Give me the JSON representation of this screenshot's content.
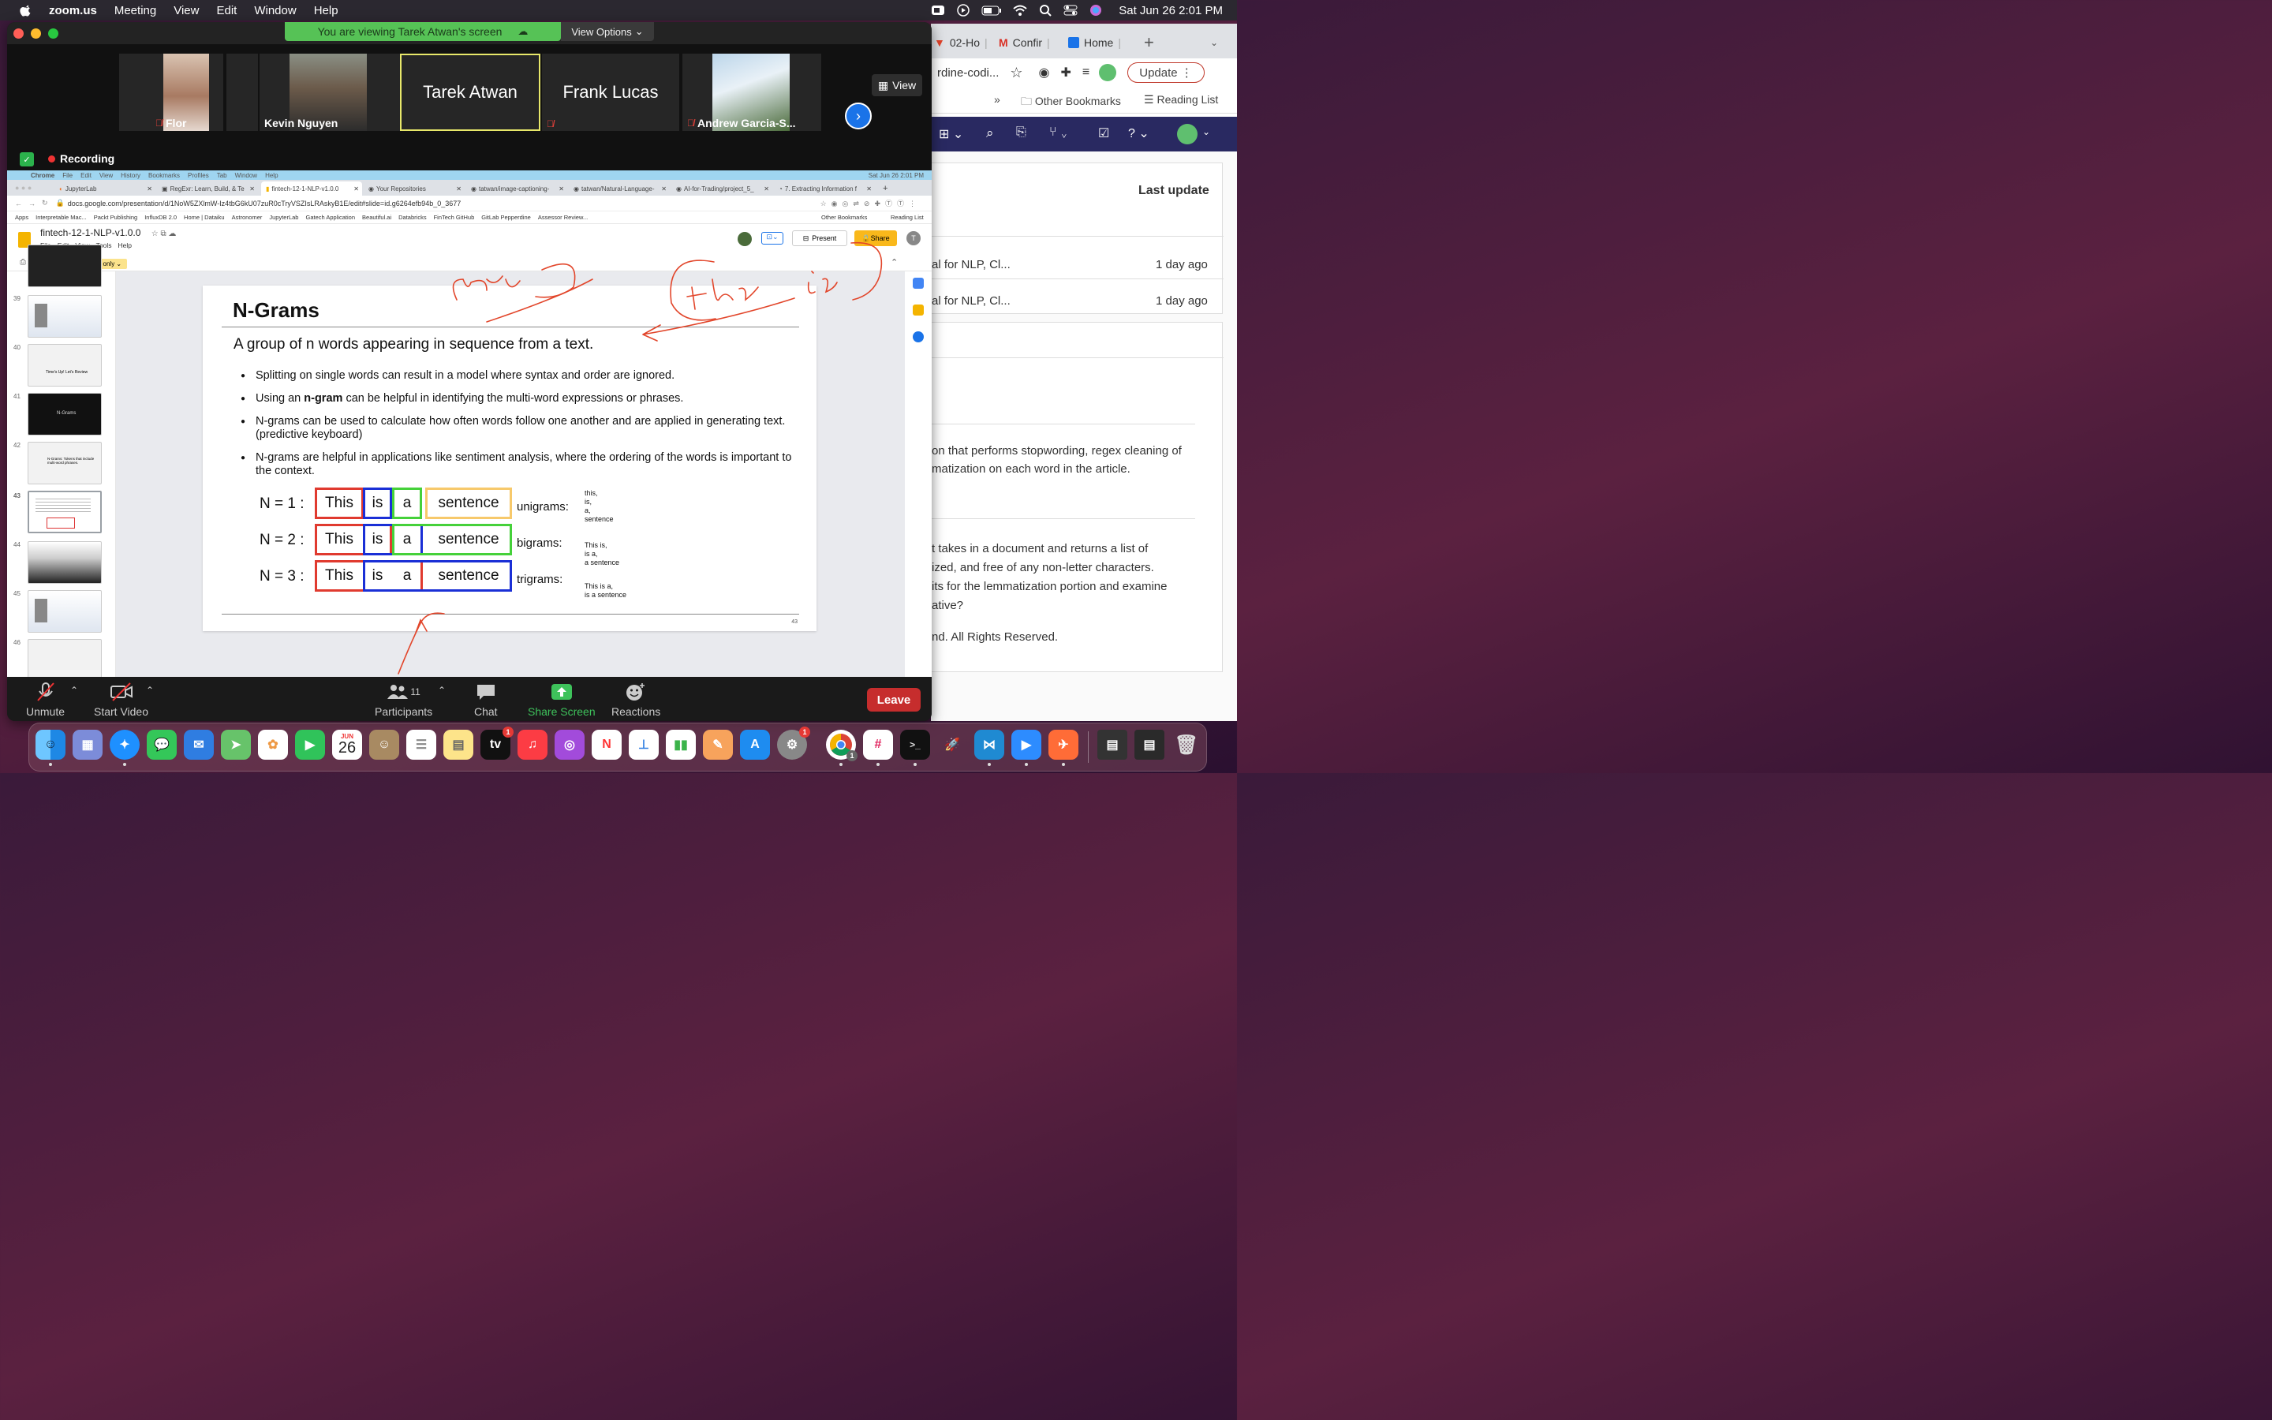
{
  "menubar": {
    "app": "zoom.us",
    "items": [
      "Meeting",
      "View",
      "Edit",
      "Window",
      "Help"
    ],
    "datetime": "Sat Jun 26  2:01 PM"
  },
  "zoom": {
    "banner": "You are viewing Tarek Atwan's screen",
    "view_options": "View Options",
    "view_button": "View",
    "recording": "Recording",
    "participants": [
      {
        "name": "Flor",
        "muted": true
      },
      {
        "name": "Kevin Nguyen",
        "muted": false
      },
      {
        "name": "Tarek Atwan",
        "muted": false,
        "active": true
      },
      {
        "name": "Frank Lucas",
        "muted": true
      },
      {
        "name": "Andrew Garcia-S...",
        "muted": true
      }
    ],
    "controls": {
      "unmute": "Unmute",
      "start_video": "Start Video",
      "participants": "Participants",
      "participants_count": "11",
      "chat": "Chat",
      "share_screen": "Share Screen",
      "reactions": "Reactions",
      "leave": "Leave"
    }
  },
  "shared": {
    "mac_menu": [
      "Chrome",
      "File",
      "Edit",
      "View",
      "History",
      "Bookmarks",
      "Profiles",
      "Tab",
      "Window",
      "Help"
    ],
    "mac_time": "Sat Jun 26  2:01 PM",
    "tabs": [
      "JupyterLab",
      "RegExr: Learn, Build, & Te",
      "fintech-12-1-NLP-v1.0.0",
      "Your Repositories",
      "tatwan/image-captioning-",
      "tatwan/Natural-Language-",
      "AI-for-Trading/project_5_",
      "7. Extracting Information f"
    ],
    "url": "docs.google.com/presentation/d/1NoW5ZXlmW-Iz4tbG6kU07zuR0cTryVSZIsLRAskyB1E/edit#slide=id.g6264efb94b_0_3677",
    "bookmarks": [
      "Apps",
      "Interpretable Mac...",
      "Packt Publishing",
      "InfluxDB 2.0",
      "Home | Dataiku",
      "Astronomer",
      "JupyterLab",
      "Gatech Application",
      "Beautiful.ai",
      "Databricks",
      "FinTech GitHub",
      "GitLab Pepperdine",
      "Assessor Review..."
    ],
    "bookmarks_right": [
      "Other Bookmarks",
      "Reading List"
    ],
    "doc_title": "fintech-12-1-NLP-v1.0.0",
    "doc_menu": [
      "File",
      "Edit",
      "View",
      "Tools",
      "Help"
    ],
    "present": "Present",
    "share": "Share",
    "avatar": "T",
    "view_only": "View only",
    "thumb_numbers": [
      "39",
      "40",
      "41",
      "42",
      "43",
      "44",
      "45",
      "46"
    ],
    "thumb_texts": {
      "t40": "Time's Up! Let's Review",
      "t41": "N-Grams",
      "t42": "N-Grams: Tokens that include multi-word phrases."
    }
  },
  "slide": {
    "title": "N-Grams",
    "subtitle": "A group of n words appearing in sequence from a text.",
    "bullets": [
      "Splitting on single words can result in a model where syntax and order are ignored.",
      "N-grams can be used to calculate how often words follow one another and are applied in generating text. (predictive keyboard)",
      "N-grams are helpful in applications like sentiment analysis, where the ordering of the words is important to the context."
    ],
    "bullet2": {
      "pre": "Using an ",
      "bold": "n-gram",
      "post": " can be helpful in identifying the multi-word expressions or phrases."
    },
    "rows": [
      {
        "label": "N = 1 :",
        "gram": "unigrams:",
        "words": [
          "This",
          "is",
          "a",
          "sentence"
        ],
        "list": [
          "this,",
          "is,",
          "a,",
          "sentence"
        ]
      },
      {
        "label": "N = 2 :",
        "gram": "bigrams:",
        "words": [
          "This",
          "is",
          "a",
          "sentence"
        ],
        "list": [
          "This is,",
          "is a,",
          "a sentence"
        ]
      },
      {
        "label": "N = 3 :",
        "gram": "trigrams:",
        "words": [
          "This",
          "is",
          "a",
          "sentence"
        ],
        "list": [
          "This is a,",
          "is a sentence"
        ]
      }
    ],
    "page": "43"
  },
  "right_browser": {
    "tabs": [
      "02-Ho",
      "Confir",
      "Home"
    ],
    "address_frag": "rdine-codi...",
    "update": "Update",
    "bookmarks": [
      "Other Bookmarks",
      "Reading List"
    ],
    "last_update_header": "Last update",
    "rows": [
      {
        "name": "al for NLP, Cl...",
        "time": "1 day ago"
      },
      {
        "name": "al for NLP, Cl...",
        "time": "1 day ago"
      }
    ],
    "text1": [
      "on that performs stopwording, regex cleaning of",
      "matization on each word in the article."
    ],
    "text2": [
      "t takes in a document and returns a list of",
      "ized, and free of any non-letter characters.",
      "its for the lemmatization portion and examine",
      "ative?"
    ],
    "copyright": "nd. All Rights Reserved."
  },
  "dock": {
    "calendar_month": "JUN",
    "calendar_day": "26",
    "badges": {
      "tv": "1",
      "settings": "1",
      "chrome": "1"
    }
  },
  "colors": {
    "zoom_green": "#56c256",
    "leave_red": "#c62d2d",
    "red": "#e03a2f",
    "blue": "#1a2fd6",
    "green": "#45d13a",
    "yellow": "#f7c96b",
    "annotation": "#e2462b"
  }
}
